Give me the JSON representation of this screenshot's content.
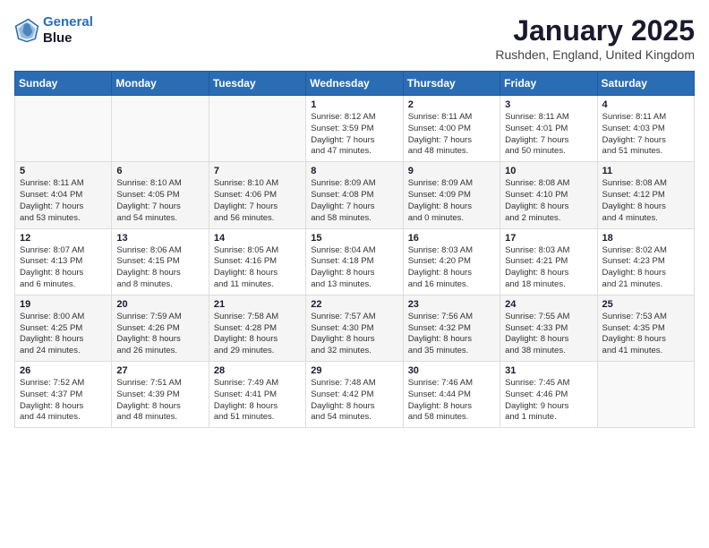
{
  "header": {
    "logo_line1": "General",
    "logo_line2": "Blue",
    "month_title": "January 2025",
    "location": "Rushden, England, United Kingdom"
  },
  "weekdays": [
    "Sunday",
    "Monday",
    "Tuesday",
    "Wednesday",
    "Thursday",
    "Friday",
    "Saturday"
  ],
  "weeks": [
    [
      {
        "day": "",
        "info": ""
      },
      {
        "day": "",
        "info": ""
      },
      {
        "day": "",
        "info": ""
      },
      {
        "day": "1",
        "info": "Sunrise: 8:12 AM\nSunset: 3:59 PM\nDaylight: 7 hours\nand 47 minutes."
      },
      {
        "day": "2",
        "info": "Sunrise: 8:11 AM\nSunset: 4:00 PM\nDaylight: 7 hours\nand 48 minutes."
      },
      {
        "day": "3",
        "info": "Sunrise: 8:11 AM\nSunset: 4:01 PM\nDaylight: 7 hours\nand 50 minutes."
      },
      {
        "day": "4",
        "info": "Sunrise: 8:11 AM\nSunset: 4:03 PM\nDaylight: 7 hours\nand 51 minutes."
      }
    ],
    [
      {
        "day": "5",
        "info": "Sunrise: 8:11 AM\nSunset: 4:04 PM\nDaylight: 7 hours\nand 53 minutes."
      },
      {
        "day": "6",
        "info": "Sunrise: 8:10 AM\nSunset: 4:05 PM\nDaylight: 7 hours\nand 54 minutes."
      },
      {
        "day": "7",
        "info": "Sunrise: 8:10 AM\nSunset: 4:06 PM\nDaylight: 7 hours\nand 56 minutes."
      },
      {
        "day": "8",
        "info": "Sunrise: 8:09 AM\nSunset: 4:08 PM\nDaylight: 7 hours\nand 58 minutes."
      },
      {
        "day": "9",
        "info": "Sunrise: 8:09 AM\nSunset: 4:09 PM\nDaylight: 8 hours\nand 0 minutes."
      },
      {
        "day": "10",
        "info": "Sunrise: 8:08 AM\nSunset: 4:10 PM\nDaylight: 8 hours\nand 2 minutes."
      },
      {
        "day": "11",
        "info": "Sunrise: 8:08 AM\nSunset: 4:12 PM\nDaylight: 8 hours\nand 4 minutes."
      }
    ],
    [
      {
        "day": "12",
        "info": "Sunrise: 8:07 AM\nSunset: 4:13 PM\nDaylight: 8 hours\nand 6 minutes."
      },
      {
        "day": "13",
        "info": "Sunrise: 8:06 AM\nSunset: 4:15 PM\nDaylight: 8 hours\nand 8 minutes."
      },
      {
        "day": "14",
        "info": "Sunrise: 8:05 AM\nSunset: 4:16 PM\nDaylight: 8 hours\nand 11 minutes."
      },
      {
        "day": "15",
        "info": "Sunrise: 8:04 AM\nSunset: 4:18 PM\nDaylight: 8 hours\nand 13 minutes."
      },
      {
        "day": "16",
        "info": "Sunrise: 8:03 AM\nSunset: 4:20 PM\nDaylight: 8 hours\nand 16 minutes."
      },
      {
        "day": "17",
        "info": "Sunrise: 8:03 AM\nSunset: 4:21 PM\nDaylight: 8 hours\nand 18 minutes."
      },
      {
        "day": "18",
        "info": "Sunrise: 8:02 AM\nSunset: 4:23 PM\nDaylight: 8 hours\nand 21 minutes."
      }
    ],
    [
      {
        "day": "19",
        "info": "Sunrise: 8:00 AM\nSunset: 4:25 PM\nDaylight: 8 hours\nand 24 minutes."
      },
      {
        "day": "20",
        "info": "Sunrise: 7:59 AM\nSunset: 4:26 PM\nDaylight: 8 hours\nand 26 minutes."
      },
      {
        "day": "21",
        "info": "Sunrise: 7:58 AM\nSunset: 4:28 PM\nDaylight: 8 hours\nand 29 minutes."
      },
      {
        "day": "22",
        "info": "Sunrise: 7:57 AM\nSunset: 4:30 PM\nDaylight: 8 hours\nand 32 minutes."
      },
      {
        "day": "23",
        "info": "Sunrise: 7:56 AM\nSunset: 4:32 PM\nDaylight: 8 hours\nand 35 minutes."
      },
      {
        "day": "24",
        "info": "Sunrise: 7:55 AM\nSunset: 4:33 PM\nDaylight: 8 hours\nand 38 minutes."
      },
      {
        "day": "25",
        "info": "Sunrise: 7:53 AM\nSunset: 4:35 PM\nDaylight: 8 hours\nand 41 minutes."
      }
    ],
    [
      {
        "day": "26",
        "info": "Sunrise: 7:52 AM\nSunset: 4:37 PM\nDaylight: 8 hours\nand 44 minutes."
      },
      {
        "day": "27",
        "info": "Sunrise: 7:51 AM\nSunset: 4:39 PM\nDaylight: 8 hours\nand 48 minutes."
      },
      {
        "day": "28",
        "info": "Sunrise: 7:49 AM\nSunset: 4:41 PM\nDaylight: 8 hours\nand 51 minutes."
      },
      {
        "day": "29",
        "info": "Sunrise: 7:48 AM\nSunset: 4:42 PM\nDaylight: 8 hours\nand 54 minutes."
      },
      {
        "day": "30",
        "info": "Sunrise: 7:46 AM\nSunset: 4:44 PM\nDaylight: 8 hours\nand 58 minutes."
      },
      {
        "day": "31",
        "info": "Sunrise: 7:45 AM\nSunset: 4:46 PM\nDaylight: 9 hours\nand 1 minute."
      },
      {
        "day": "",
        "info": ""
      }
    ]
  ]
}
